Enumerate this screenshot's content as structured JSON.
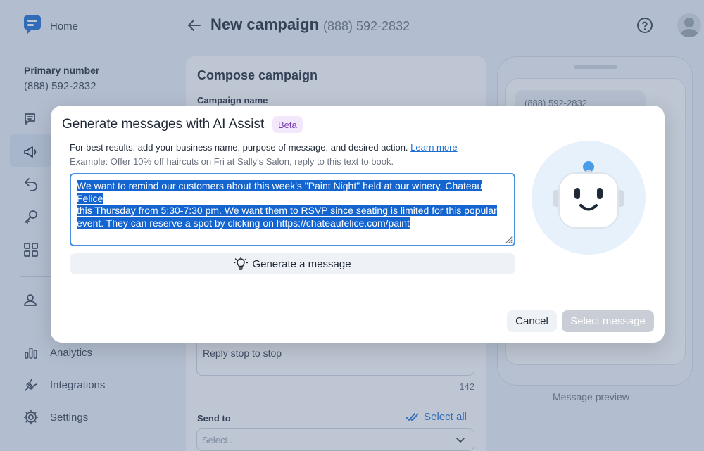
{
  "header": {
    "home_label": "Home",
    "title": "New campaign",
    "phone": "(888) 592-2832"
  },
  "sidebar": {
    "primary_label": "Primary number",
    "primary_value": "(888) 592-2832",
    "items": [
      {
        "label": "Analytics",
        "icon": "bar-chart-icon"
      },
      {
        "label": "Integrations",
        "icon": "plug-icon"
      },
      {
        "label": "Settings",
        "icon": "gear-icon"
      }
    ]
  },
  "compose": {
    "title": "Compose campaign",
    "campaign_name_label": "Campaign name",
    "reply_text": "Reply stop to stop",
    "char_count": "142",
    "send_to_label": "Send to",
    "select_all_label": "Select all",
    "select_placeholder": "Select..."
  },
  "preview": {
    "bubble_text": "(888) 592-2832",
    "label": "Message preview"
  },
  "modal": {
    "title": "Generate messages with AI Assist",
    "badge": "Beta",
    "instruction": "For best results, add your business name, purpose of message, and desired action.",
    "learn_more": "Learn more",
    "example": "Example: Offer 10% off haircuts on Fri at Sally's Salon, reply to this text to book.",
    "prompt_lines": [
      "We want to remind our customers about this week's \"Paint Night\" held at our winery, Chateau Felice",
      "this Thursday from 5:30-7:30 pm. We want them to RSVP since seating is limited for this popular",
      "event. They can reserve a spot by clicking on https://chateaufelice.com/paint"
    ],
    "generate_label": "Generate a message",
    "cancel_label": "Cancel",
    "select_label": "Select message"
  },
  "colors": {
    "accent": "#1d6fd6",
    "badge_bg": "#f3e8fb",
    "badge_text": "#7b3fb4",
    "selection": "#1565d0",
    "disabled_button": "#c9ced6"
  }
}
